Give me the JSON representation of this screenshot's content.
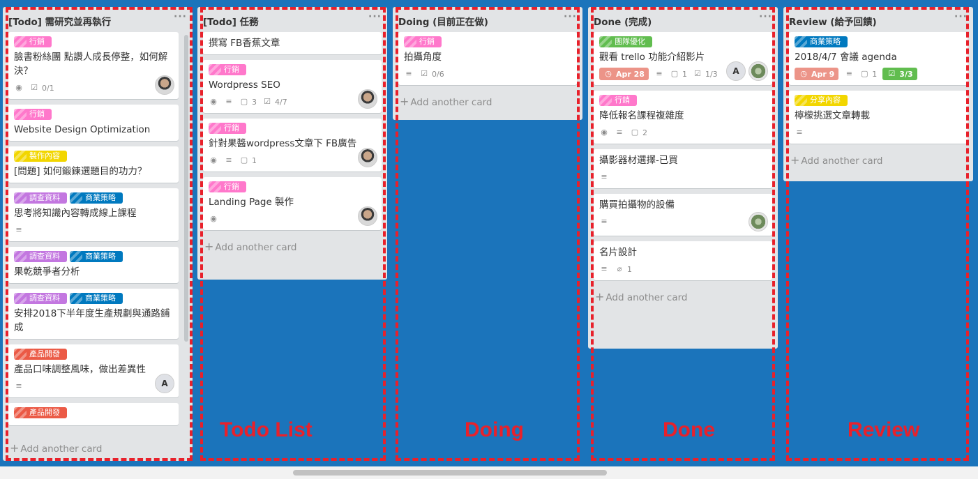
{
  "lists": [
    {
      "title": "[Todo] 需研究並再執行",
      "cards": [
        {
          "labels": [
            {
              "text": "行銷",
              "color": "#ff78cb"
            }
          ],
          "title": "臉書粉絲團 點讚人成長停整，如何解決？",
          "badges": [
            {
              "icon": "eye-icon",
              "glyph": "◉",
              "text": ""
            },
            {
              "icon": "checklist-icon",
              "glyph": "☑",
              "text": "0/1"
            }
          ],
          "members": [
            "avatar"
          ]
        },
        {
          "labels": [
            {
              "text": "行銷",
              "color": "#ff78cb"
            }
          ],
          "title": "Website Design Optimization",
          "badges": [],
          "members": []
        },
        {
          "labels": [
            {
              "text": "製作內容",
              "color": "#f2d600"
            }
          ],
          "title": "[問題] 如何鍛鍊選題目的功力？",
          "badges": [],
          "members": []
        },
        {
          "labels": [
            {
              "text": "調查資料",
              "color": "#c377e0"
            },
            {
              "text": "商業策略",
              "color": "#0079bf"
            }
          ],
          "title": "思考將知識內容轉成線上課程",
          "badges": [
            {
              "icon": "description-icon",
              "glyph": "≡",
              "text": ""
            }
          ],
          "members": []
        },
        {
          "labels": [
            {
              "text": "調查資料",
              "color": "#c377e0"
            },
            {
              "text": "商業策略",
              "color": "#0079bf"
            }
          ],
          "title": "果乾競爭者分析",
          "badges": [],
          "members": []
        },
        {
          "labels": [
            {
              "text": "調查資料",
              "color": "#c377e0"
            },
            {
              "text": "商業策略",
              "color": "#0079bf"
            }
          ],
          "title": "安排2018下半年度生產規劃與通路鋪成",
          "badges": [],
          "members": []
        },
        {
          "labels": [
            {
              "text": "產品開發",
              "color": "#eb5a46"
            }
          ],
          "title": "產品口味調整風味，做出差異性",
          "badges": [
            {
              "icon": "description-icon",
              "glyph": "≡",
              "text": ""
            }
          ],
          "members": [
            "A"
          ]
        },
        {
          "labels": [
            {
              "text": "產品開發",
              "color": "#eb5a46"
            }
          ],
          "title": "",
          "badges": [],
          "members": []
        }
      ]
    },
    {
      "title": "[Todo] 任務",
      "cards": [
        {
          "labels": [],
          "title": "撰寫 FB香蕉文章",
          "badges": [],
          "members": []
        },
        {
          "labels": [
            {
              "text": "行銷",
              "color": "#ff78cb"
            }
          ],
          "title": "Wordpress SEO",
          "badges": [
            {
              "icon": "eye-icon",
              "glyph": "◉",
              "text": ""
            },
            {
              "icon": "description-icon",
              "glyph": "≡",
              "text": ""
            },
            {
              "icon": "comment-icon",
              "glyph": "▢",
              "text": "3"
            },
            {
              "icon": "checklist-icon",
              "glyph": "☑",
              "text": "4/7"
            }
          ],
          "members": [
            "avatar"
          ]
        },
        {
          "labels": [
            {
              "text": "行銷",
              "color": "#ff78cb"
            }
          ],
          "title": "針對果醬wordpress文章下 FB廣告",
          "badges": [
            {
              "icon": "eye-icon",
              "glyph": "◉",
              "text": ""
            },
            {
              "icon": "description-icon",
              "glyph": "≡",
              "text": ""
            },
            {
              "icon": "comment-icon",
              "glyph": "▢",
              "text": "1"
            }
          ],
          "members": [
            "avatar"
          ]
        },
        {
          "labels": [
            {
              "text": "行銷",
              "color": "#ff78cb"
            }
          ],
          "title": "Landing Page 製作",
          "badges": [
            {
              "icon": "eye-icon",
              "glyph": "◉",
              "text": ""
            }
          ],
          "members": [
            "avatar"
          ]
        }
      ]
    },
    {
      "title": "Doing (目前正在做)",
      "cards": [
        {
          "labels": [
            {
              "text": "行銷",
              "color": "#ff78cb"
            }
          ],
          "title": "拍攝角度",
          "badges": [
            {
              "icon": "description-icon",
              "glyph": "≡",
              "text": ""
            },
            {
              "icon": "checklist-icon",
              "glyph": "☑",
              "text": "0/6"
            }
          ],
          "members": []
        }
      ]
    },
    {
      "title": "Done (完成)",
      "cards": [
        {
          "labels": [
            {
              "text": "團隊優化",
              "color": "#61bd4f"
            }
          ],
          "title": "觀看 trello 功能介紹影片",
          "badges": [
            {
              "icon": "clock-icon",
              "glyph": "◷",
              "text": "Apr 28",
              "style": "due"
            },
            {
              "icon": "description-icon",
              "glyph": "≡",
              "text": ""
            },
            {
              "icon": "comment-icon",
              "glyph": "▢",
              "text": "1"
            },
            {
              "icon": "checklist-icon",
              "glyph": "☑",
              "text": "1/3"
            }
          ],
          "members": [
            "A",
            "plant"
          ]
        },
        {
          "labels": [
            {
              "text": "行銷",
              "color": "#ff78cb"
            }
          ],
          "title": "降低報名課程複雜度",
          "badges": [
            {
              "icon": "eye-icon",
              "glyph": "◉",
              "text": ""
            },
            {
              "icon": "description-icon",
              "glyph": "≡",
              "text": ""
            },
            {
              "icon": "comment-icon",
              "glyph": "▢",
              "text": "2"
            }
          ],
          "members": []
        },
        {
          "labels": [],
          "title": "攝影器材選擇-已買",
          "badges": [
            {
              "icon": "description-icon",
              "glyph": "≡",
              "text": ""
            }
          ],
          "members": []
        },
        {
          "labels": [],
          "title": "購買拍攝物的設備",
          "badges": [
            {
              "icon": "description-icon",
              "glyph": "≡",
              "text": ""
            }
          ],
          "members": [
            "plant"
          ]
        },
        {
          "labels": [],
          "title": "名片設計",
          "badges": [
            {
              "icon": "description-icon",
              "glyph": "≡",
              "text": ""
            },
            {
              "icon": "attachment-icon",
              "glyph": "⌀",
              "text": "1"
            }
          ],
          "members": []
        }
      ]
    },
    {
      "title": "Review (給予回饋)",
      "cards": [
        {
          "labels": [
            {
              "text": "商業策略",
              "color": "#0079bf"
            }
          ],
          "title": "2018/4/7 會議 agenda",
          "badges": [
            {
              "icon": "clock-icon",
              "glyph": "◷",
              "text": "Apr 9",
              "style": "due"
            },
            {
              "icon": "description-icon",
              "glyph": "≡",
              "text": ""
            },
            {
              "icon": "comment-icon",
              "glyph": "▢",
              "text": "1"
            },
            {
              "icon": "checklist-icon",
              "glyph": "☑",
              "text": "3/3",
              "style": "check-done"
            }
          ],
          "members": []
        },
        {
          "labels": [
            {
              "text": "分享內容",
              "color": "#f2d600"
            }
          ],
          "title": "檸檬挑選文章轉載",
          "badges": [
            {
              "icon": "description-icon",
              "glyph": "≡",
              "text": ""
            }
          ],
          "members": []
        }
      ]
    }
  ],
  "add_card_label": "Add another card",
  "list_menu_glyph": "···",
  "overlay_labels": [
    "Todo List",
    "Doing",
    "Done",
    "Review"
  ]
}
